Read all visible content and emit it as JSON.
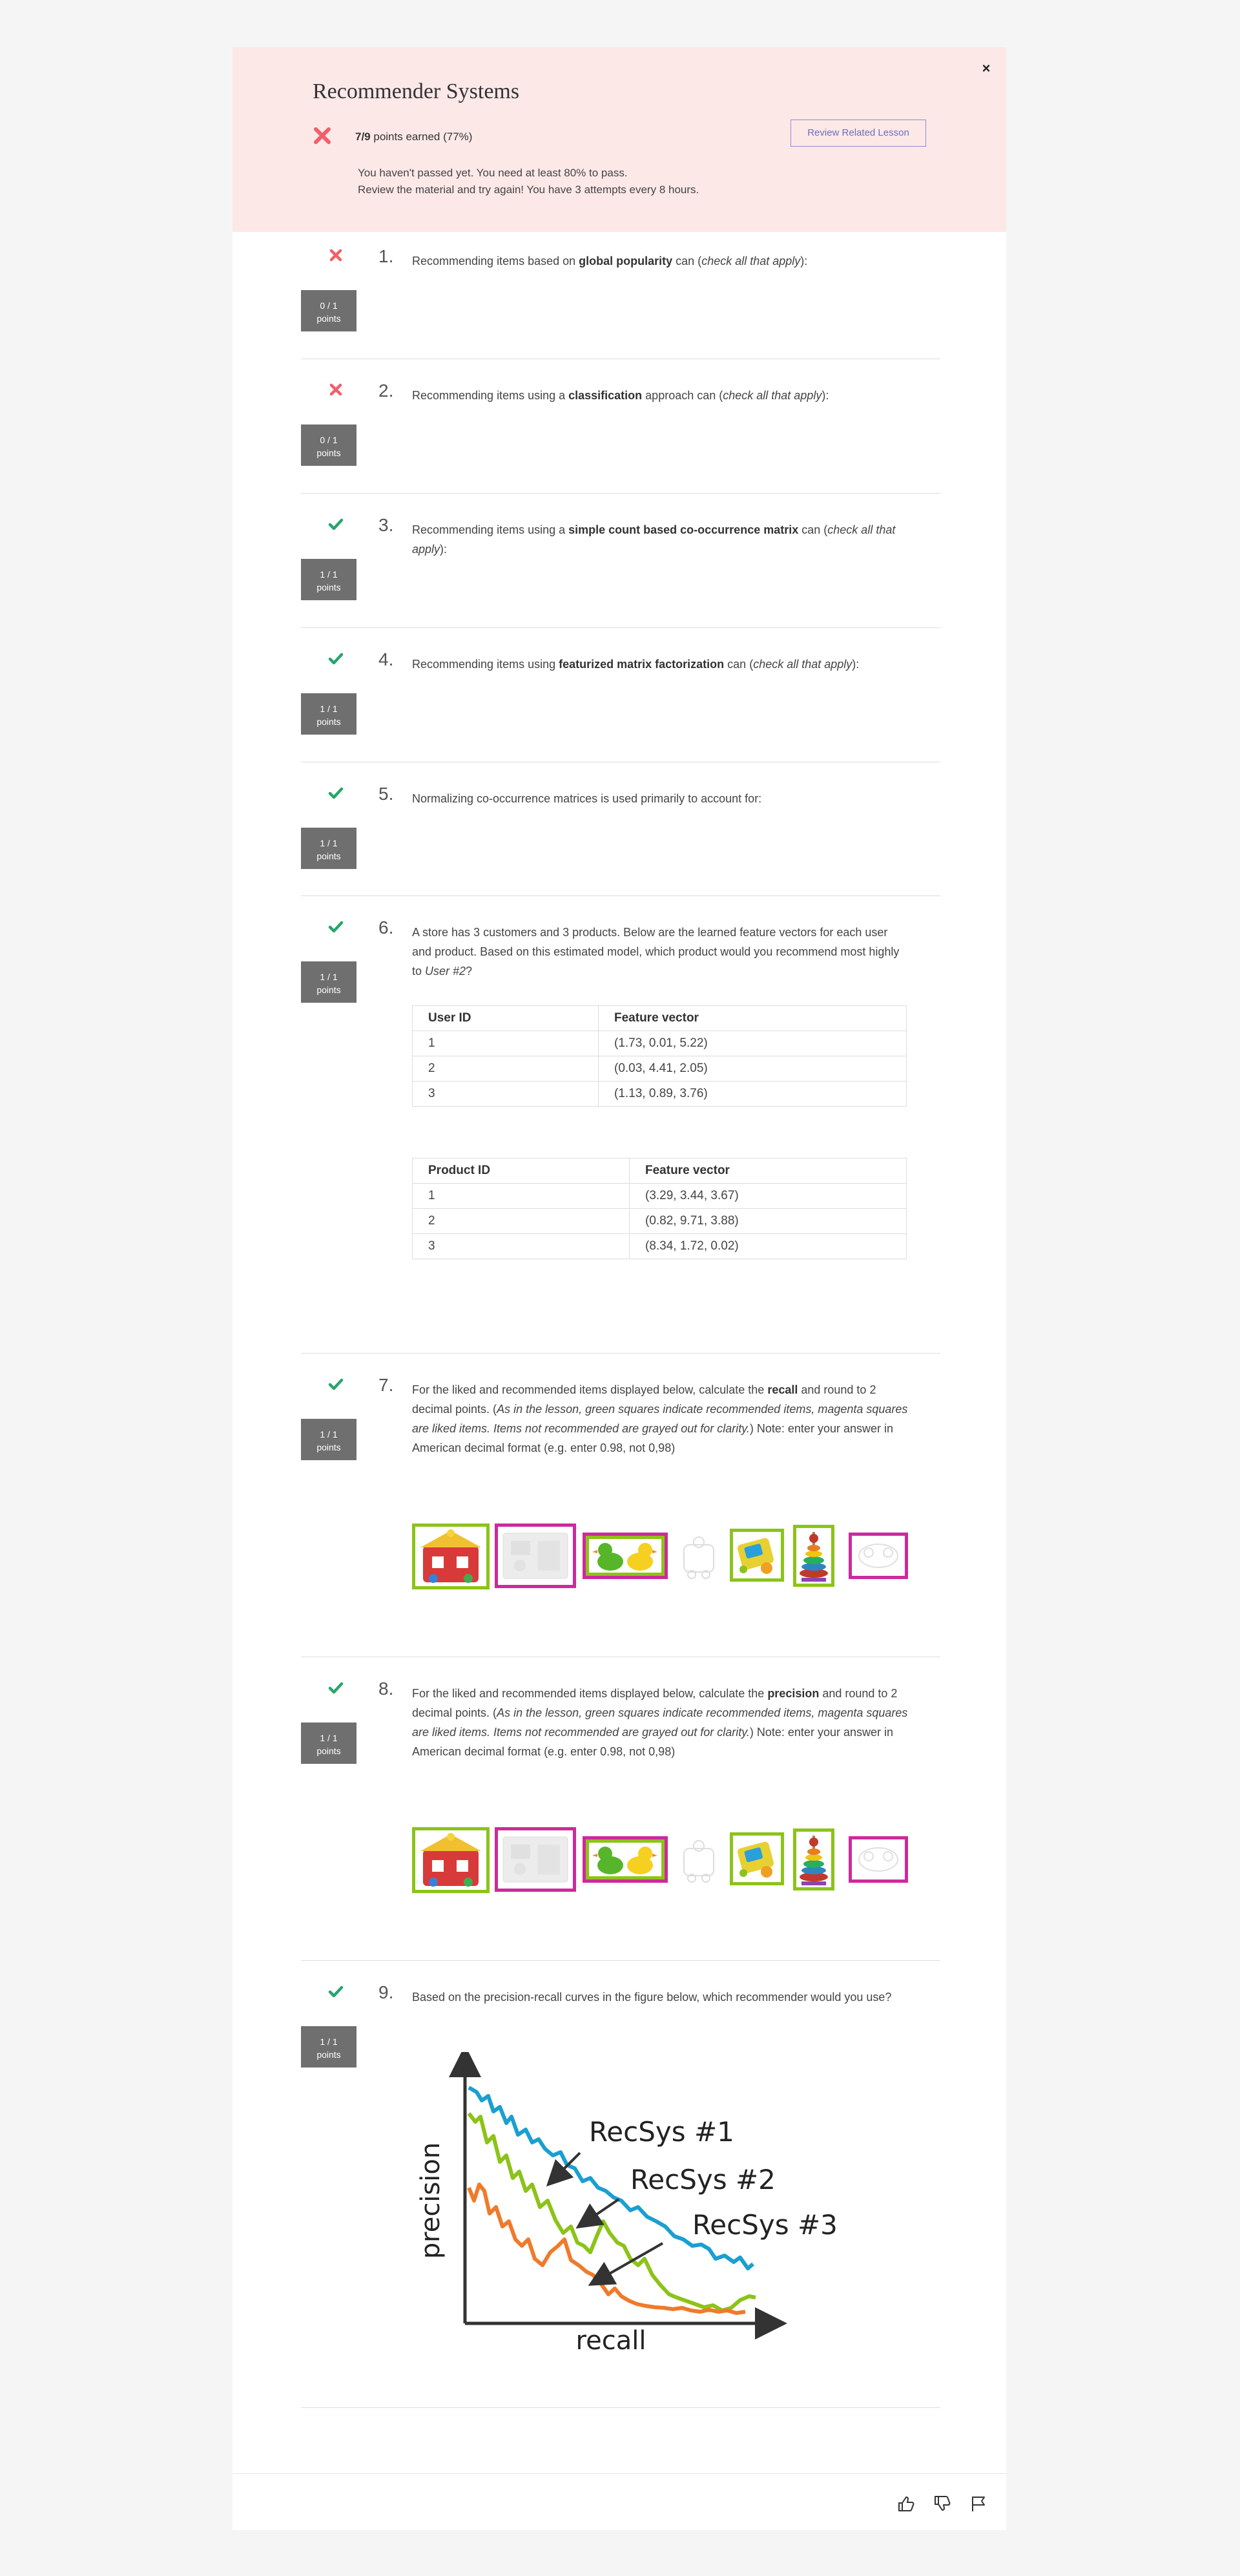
{
  "quiz": {
    "title": "Recommender Systems",
    "close_glyph": "×",
    "score_strong": "7/9",
    "score_rest": " points earned (77%)",
    "review_label": "Review Related Lesson",
    "fail_line1": "You haven't passed yet. You need at least 80% to pass.",
    "fail_line2": "Review the material and try again!  You have 3 attempts every 8 hours."
  },
  "colors": {
    "correct": "#27a66d",
    "incorrect": "#f0606a",
    "header_bg": "#fde8e8",
    "badge_bg": "#6f6f6f",
    "green_border": "#8cc318",
    "magenta_border": "#cc2a9c"
  },
  "questions": [
    {
      "num": "1.",
      "status": "incorrect",
      "badge": "0 / 1",
      "badge_unit": "points",
      "t1": "Recommending items based on ",
      "b1": "global popularity",
      "t2": " can (",
      "i1": "check all that apply",
      "t3": "):"
    },
    {
      "num": "2.",
      "status": "incorrect",
      "badge": "0 / 1",
      "badge_unit": "points",
      "t1": "Recommending items using a ",
      "b1": "classification",
      "t2": " approach can (",
      "i1": "check all that apply",
      "t3": "):"
    },
    {
      "num": "3.",
      "status": "correct",
      "badge": "1 / 1",
      "badge_unit": "points",
      "t1": "Recommending items using a ",
      "b1": "simple count based co-occurrence matrix",
      "t2": " can (",
      "i1": "check all that apply",
      "t3": "):"
    },
    {
      "num": "4.",
      "status": "correct",
      "badge": "1 / 1",
      "badge_unit": "points",
      "t1": "Recommending items using ",
      "b1": "featurized matrix factorization",
      "t2": " can (",
      "i1": "check all that apply",
      "t3": "):"
    },
    {
      "num": "5.",
      "status": "correct",
      "badge": "1 / 1",
      "badge_unit": "points",
      "t1": "Normalizing co-occurrence matrices is used primarily to account for:"
    },
    {
      "num": "6.",
      "status": "correct",
      "badge": "1 / 1",
      "badge_unit": "points",
      "t1": "A store has 3 customers and 3 products. Below are the learned feature vectors for each user and product. Based on this estimated model, which product would you recommend most highly to ",
      "i1": "User #2",
      "t2": "?"
    },
    {
      "num": "7.",
      "status": "correct",
      "badge": "1 / 1",
      "badge_unit": "points",
      "t1": "For the liked and recommended items displayed below, calculate the ",
      "b1": "recall",
      "t2": " and round to 2 decimal points. (",
      "i1": "As in the lesson, green squares indicate recommended items, magenta squares are liked items. Items not recommended are grayed out for clarity.",
      "t3": ") Note: enter your answer in American decimal format (e.g. enter 0.98, not 0,98)"
    },
    {
      "num": "8.",
      "status": "correct",
      "badge": "1 / 1",
      "badge_unit": "points",
      "t1": "For the liked and recommended items displayed below, calculate the ",
      "b1": "precision",
      "t2": " and round to 2 decimal points. (",
      "i1": "As in the lesson, green squares indicate recommended items, magenta squares are liked items. Items not recommended are grayed out for clarity.",
      "t3": ") Note: enter your answer in American decimal format (e.g. enter 0.98, not 0,98)"
    },
    {
      "num": "9.",
      "status": "correct",
      "badge": "1 / 1",
      "badge_unit": "points",
      "t1": "Based on the precision-recall curves in the figure below, which recommender would you use?"
    }
  ],
  "user_table": {
    "headers": [
      "User ID",
      "Feature vector"
    ],
    "rows": [
      [
        "1",
        "(1.73, 0.01, 5.22)"
      ],
      [
        "2",
        "(0.03, 4.41, 2.05)"
      ],
      [
        "3",
        "(1.13, 0.89, 3.76)"
      ]
    ]
  },
  "product_table": {
    "headers": [
      "Product ID",
      "Feature vector"
    ],
    "rows": [
      [
        "1",
        "(3.29, 3.44, 3.67)"
      ],
      [
        "2",
        "(0.82, 9.71, 3.88)"
      ],
      [
        "3",
        "(8.34, 1.72, 0.02)"
      ]
    ]
  },
  "items": [
    {
      "icon": "toy-shop-icon",
      "border": "green"
    },
    {
      "icon": "grayed-toy-icon",
      "border": "magenta"
    },
    {
      "icon": "rubber-ducks-icon",
      "border": "both"
    },
    {
      "icon": "grayed-toy-icon",
      "border": "none"
    },
    {
      "icon": "toy-phone-icon",
      "border": "green"
    },
    {
      "icon": "ring-stacker-icon",
      "border": "green"
    },
    {
      "icon": "grayed-toy-icon",
      "border": "magenta"
    }
  ],
  "pr_figure": {
    "xlabel": "recall",
    "ylabel": "precision",
    "label1": "RecSys #1",
    "label2": "RecSys #2",
    "label3": "RecSys #3",
    "colors": [
      "#1a9fd1",
      "#8cc318",
      "#f07a2a"
    ]
  },
  "footer": {
    "icons": [
      "thumbs-up-icon",
      "thumbs-down-icon",
      "flag-icon"
    ]
  }
}
